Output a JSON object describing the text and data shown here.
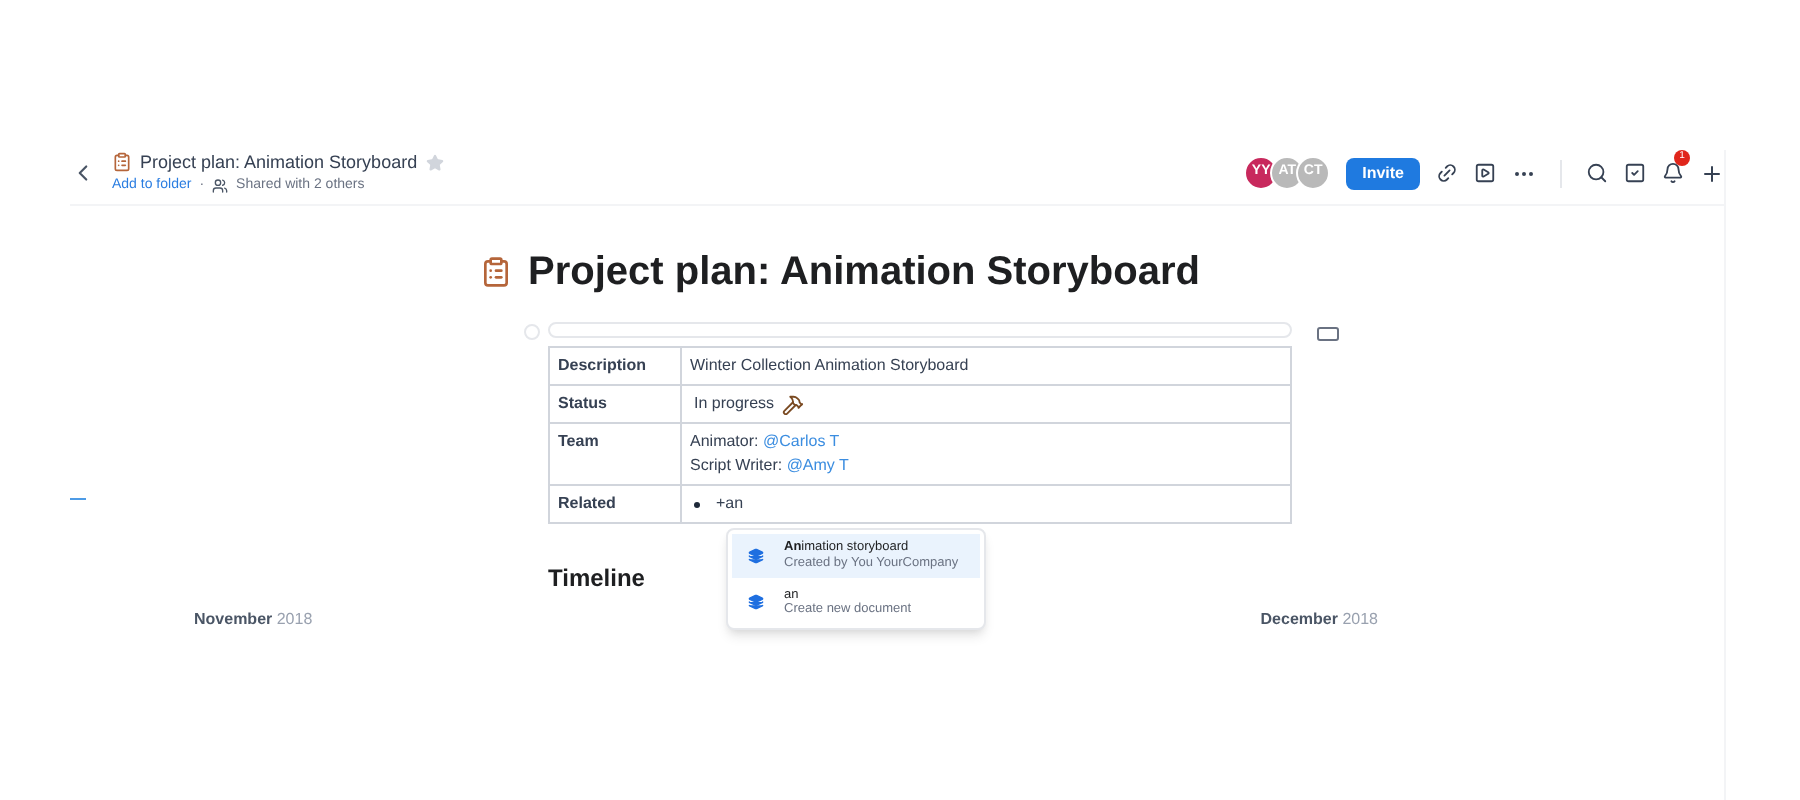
{
  "header": {
    "title": "Project plan: Animation Storyboard",
    "starred": false,
    "add_to_folder": "Add to folder",
    "separator": "·",
    "shared": "Shared with 2 others"
  },
  "avatars": [
    {
      "initials": "YY",
      "color": "#c8295d"
    },
    {
      "initials": "AT",
      "color": "#b9b9b9"
    },
    {
      "initials": "CT",
      "color": "#b9b9b9"
    }
  ],
  "invite_button": "Invite",
  "notification_badge": "1",
  "document": {
    "title": "Project plan: Animation Storyboard",
    "table": [
      {
        "label": "Description",
        "kind": "text",
        "value": "Winter Collection Animation Storyboard"
      },
      {
        "label": "Status",
        "kind": "status",
        "value": "In progress"
      },
      {
        "label": "Team",
        "kind": "mentions",
        "lines": [
          {
            "role": "Animator:",
            "mention": "@Carlos T"
          },
          {
            "role": "Script Writer:",
            "mention": "@Amy T"
          }
        ]
      },
      {
        "label": "Related",
        "kind": "bullet",
        "value": "+an"
      }
    ],
    "suggestions": [
      {
        "title": "**An**imation storyboard",
        "subtitle": "Created by You YourCompany",
        "selected": true
      },
      {
        "title": "an",
        "subtitle": "Create new document",
        "selected": false
      }
    ],
    "section_heading": "Timeline",
    "months": [
      {
        "month": "November",
        "year": "2018"
      },
      {
        "month": "December",
        "year": "2018"
      }
    ]
  }
}
